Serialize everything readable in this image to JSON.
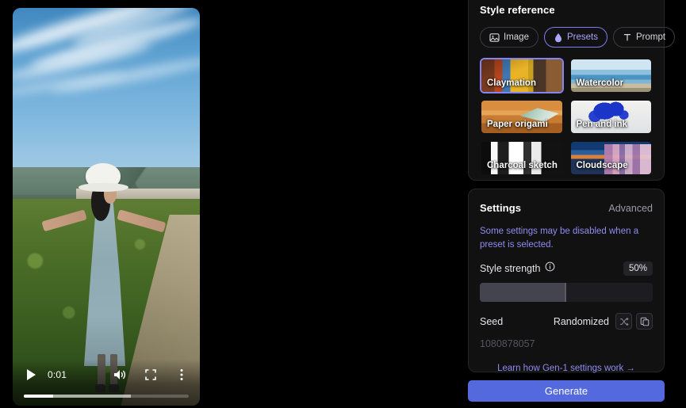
{
  "video": {
    "current_time": "0:01",
    "play_icon": "play-icon",
    "volume_icon": "volume-icon",
    "fullscreen_icon": "fullscreen-icon",
    "more_icon": "more-vertical-icon",
    "progress_played_pct": 18,
    "progress_buffered_pct": 65
  },
  "style_reference": {
    "title": "Style reference",
    "tabs": [
      {
        "label": "Image",
        "icon": "image-icon",
        "active": false
      },
      {
        "label": "Presets",
        "icon": "droplet-icon",
        "active": true
      },
      {
        "label": "Prompt",
        "icon": "text-t-icon",
        "active": false
      }
    ],
    "presets": [
      {
        "label": "Claymation",
        "selected": true
      },
      {
        "label": "Watercolor",
        "selected": false
      },
      {
        "label": "Paper origami",
        "selected": false
      },
      {
        "label": "Pen and ink",
        "selected": false
      },
      {
        "label": "Charcoal sketch",
        "selected": false
      },
      {
        "label": "Cloudscape",
        "selected": false
      }
    ]
  },
  "settings": {
    "title": "Settings",
    "advanced_label": "Advanced",
    "notice": "Some settings may be disabled when a preset is selected.",
    "style_strength": {
      "label": "Style strength",
      "info_icon": "info-icon",
      "value_label": "50%",
      "value_pct": 50
    },
    "seed": {
      "label": "Seed",
      "mode": "Randomized",
      "value": "1080878057",
      "shuffle_icon": "shuffle-icon",
      "copy_icon": "copy-icon"
    },
    "learn_link": "Learn how Gen-1 settings work →"
  },
  "generate_button": {
    "label": "Generate"
  },
  "colors": {
    "accent": "#5569de",
    "preset_selected_ring": "#8684f2",
    "link_purple": "#8f8cf0",
    "panel_bg": "#111111",
    "page_bg": "#000000"
  }
}
